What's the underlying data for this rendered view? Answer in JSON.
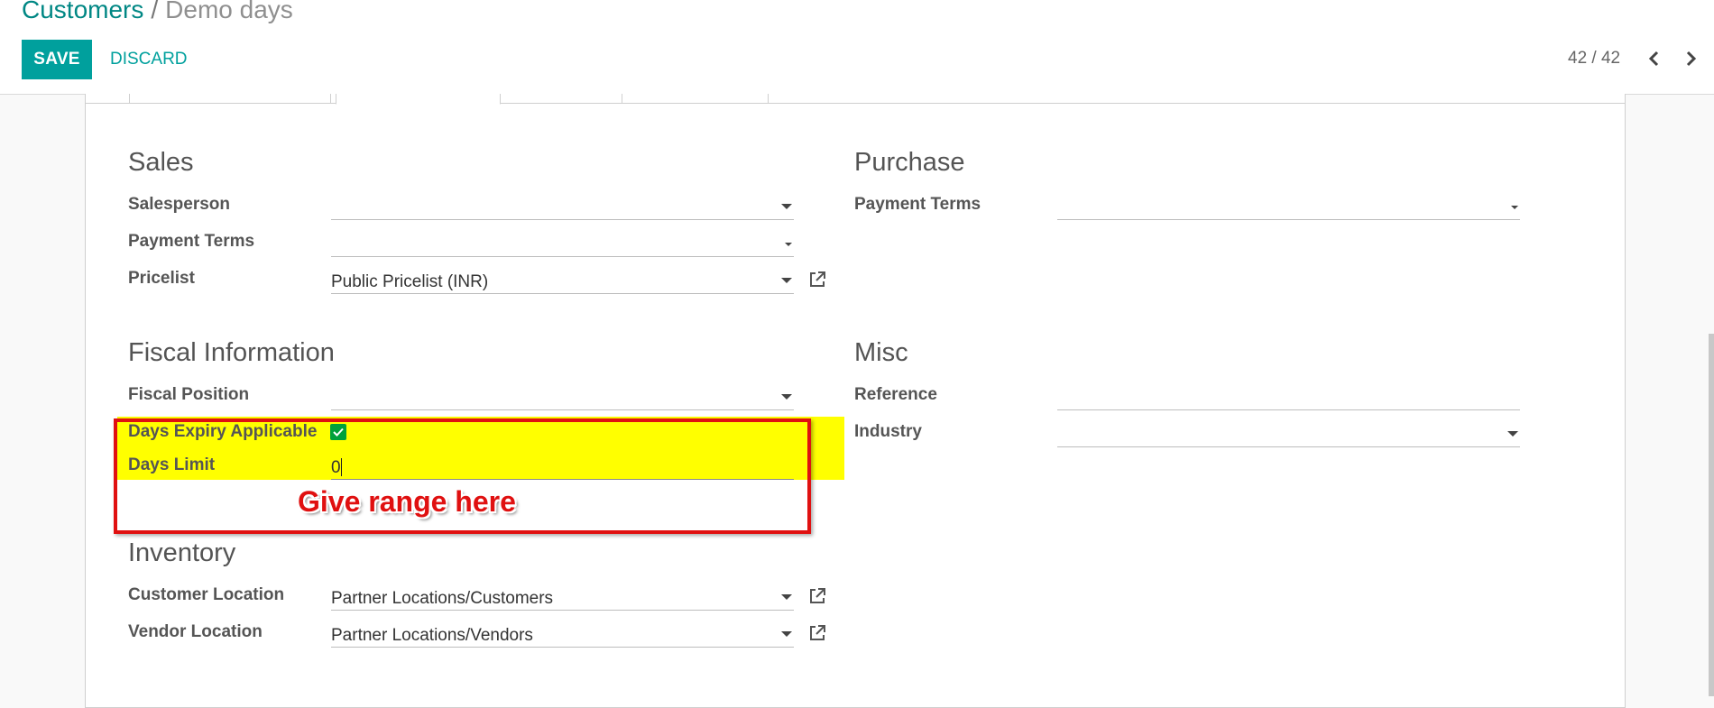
{
  "breadcrumb": {
    "parent": "Customers",
    "separator": "/",
    "current": "Demo days"
  },
  "toolbar": {
    "save_label": "SAVE",
    "discard_label": "DISCARD"
  },
  "pager": {
    "value": "42 / 42"
  },
  "sales": {
    "title": "Sales",
    "salesperson_label": "Salesperson",
    "salesperson_value": "",
    "payment_terms_label": "Payment Terms",
    "payment_terms_value": "",
    "pricelist_label": "Pricelist",
    "pricelist_value": "Public Pricelist (INR)"
  },
  "purchase": {
    "title": "Purchase",
    "payment_terms_label": "Payment Terms",
    "payment_terms_value": ""
  },
  "fiscal": {
    "title": "Fiscal Information",
    "fiscal_position_label": "Fiscal Position",
    "fiscal_position_value": "",
    "days_expiry_label": "Days Expiry Applicable",
    "days_expiry_checked": true,
    "days_limit_label": "Days Limit",
    "days_limit_value": "0"
  },
  "misc": {
    "title": "Misc",
    "reference_label": "Reference",
    "reference_value": "",
    "industry_label": "Industry",
    "industry_value": ""
  },
  "inventory": {
    "title": "Inventory",
    "customer_location_label": "Customer Location",
    "customer_location_value": "Partner Locations/Customers",
    "vendor_location_label": "Vendor Location",
    "vendor_location_value": "Partner Locations/Vendors"
  },
  "annotation": {
    "text": "Give range here",
    "color": "#e01010",
    "highlight_color": "#ffff00"
  },
  "colors": {
    "brand": "#00a09d",
    "link": "#008784",
    "checkbox": "#00a13b"
  },
  "icons": {
    "prev": "chevron-left-icon",
    "next": "chevron-right-icon",
    "external": "external-link-icon",
    "dropdown": "caret-down-icon",
    "check": "check-icon"
  }
}
